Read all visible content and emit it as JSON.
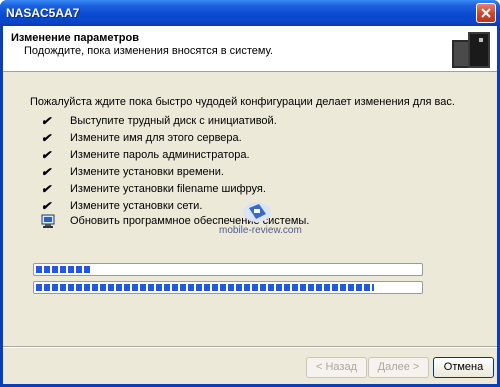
{
  "window": {
    "title": "NASAC5AA7"
  },
  "header": {
    "title": "Изменение параметров",
    "subtitle": "Подождите, пока изменения вносятся в систему."
  },
  "main": {
    "intro": "Пожалуйста ждите пока быстро чудодей конфигурации делает изменения для вас.",
    "tasks": [
      {
        "label": "Выступите трудный диск с инициативой.",
        "status": "done",
        "icon": "checkmark-icon"
      },
      {
        "label": "Измените имя для этого сервера.",
        "status": "done",
        "icon": "checkmark-icon"
      },
      {
        "label": "Измените пароль администратора.",
        "status": "done",
        "icon": "checkmark-icon"
      },
      {
        "label": "Измените установки времени.",
        "status": "done",
        "icon": "checkmark-icon"
      },
      {
        "label": "Измените установки filename шифруя.",
        "status": "done",
        "icon": "checkmark-icon"
      },
      {
        "label": "Измените установки сети.",
        "status": "done",
        "icon": "checkmark-icon"
      },
      {
        "label": "Обновить программное обеспечение системы.",
        "status": "in-progress",
        "icon": "computer-icon"
      }
    ],
    "progress_current_fraction": 0.145,
    "progress_overall_fraction": 0.88,
    "progress_color": "#2158e6"
  },
  "watermark": {
    "text": "mobile-review.com"
  },
  "buttons": {
    "back": "< Назад",
    "next": "Далее >",
    "cancel": "Отмена"
  }
}
